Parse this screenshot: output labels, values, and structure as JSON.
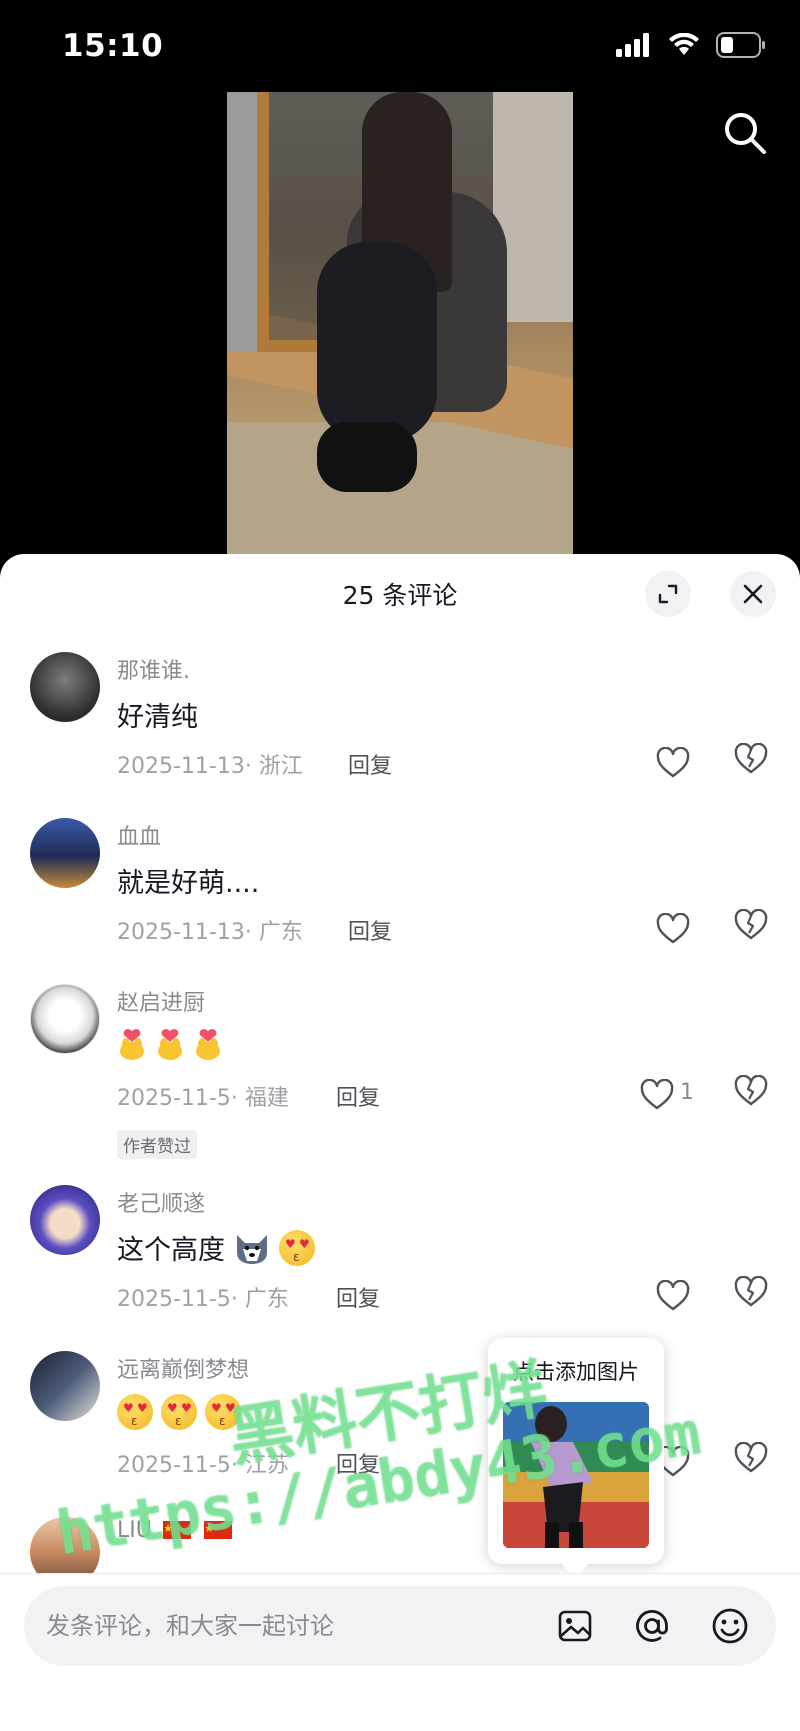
{
  "status_bar": {
    "time": "15:10"
  },
  "sheet": {
    "title": "25 条评论"
  },
  "comments": [
    {
      "user": "那谁谁.",
      "text": "好清纯",
      "meta": "2025-11-13· 浙江",
      "reply": "回复",
      "likes": ""
    },
    {
      "user": "血血",
      "text": "就是好萌....",
      "meta": "2025-11-13· 广东",
      "reply": "回复",
      "likes": ""
    },
    {
      "user": "赵启进厨",
      "text": "",
      "meta": "2025-11-5· 福建",
      "reply": "回复",
      "likes": "1",
      "badge": "作者赞过"
    },
    {
      "user": "老己顺遂",
      "text": "这个高度",
      "meta": "2025-11-5· 广东",
      "reply": "回复",
      "likes": ""
    },
    {
      "user": "远离巅倒梦想",
      "text": "",
      "meta": "2025-11-5· 江苏",
      "reply": "回复",
      "likes": ""
    },
    {
      "user": "LIU"
    }
  ],
  "popup": {
    "label": "点击添加图片"
  },
  "input": {
    "placeholder": "发条评论，和大家一起讨论"
  },
  "watermark": {
    "line1": "黑料不打烊",
    "line2": "https://abdy43.com"
  },
  "colors": {
    "sheet_bg": "#ffffff",
    "text_primary": "#161823",
    "text_secondary": "#8a8b91",
    "watermark": "#78eb96"
  },
  "icons": [
    "search-icon",
    "expand-icon",
    "close-icon",
    "heart-icon",
    "broken-heart-icon",
    "image-icon",
    "at-icon",
    "emoji-icon",
    "signal-icon",
    "wifi-icon",
    "battery-icon"
  ]
}
